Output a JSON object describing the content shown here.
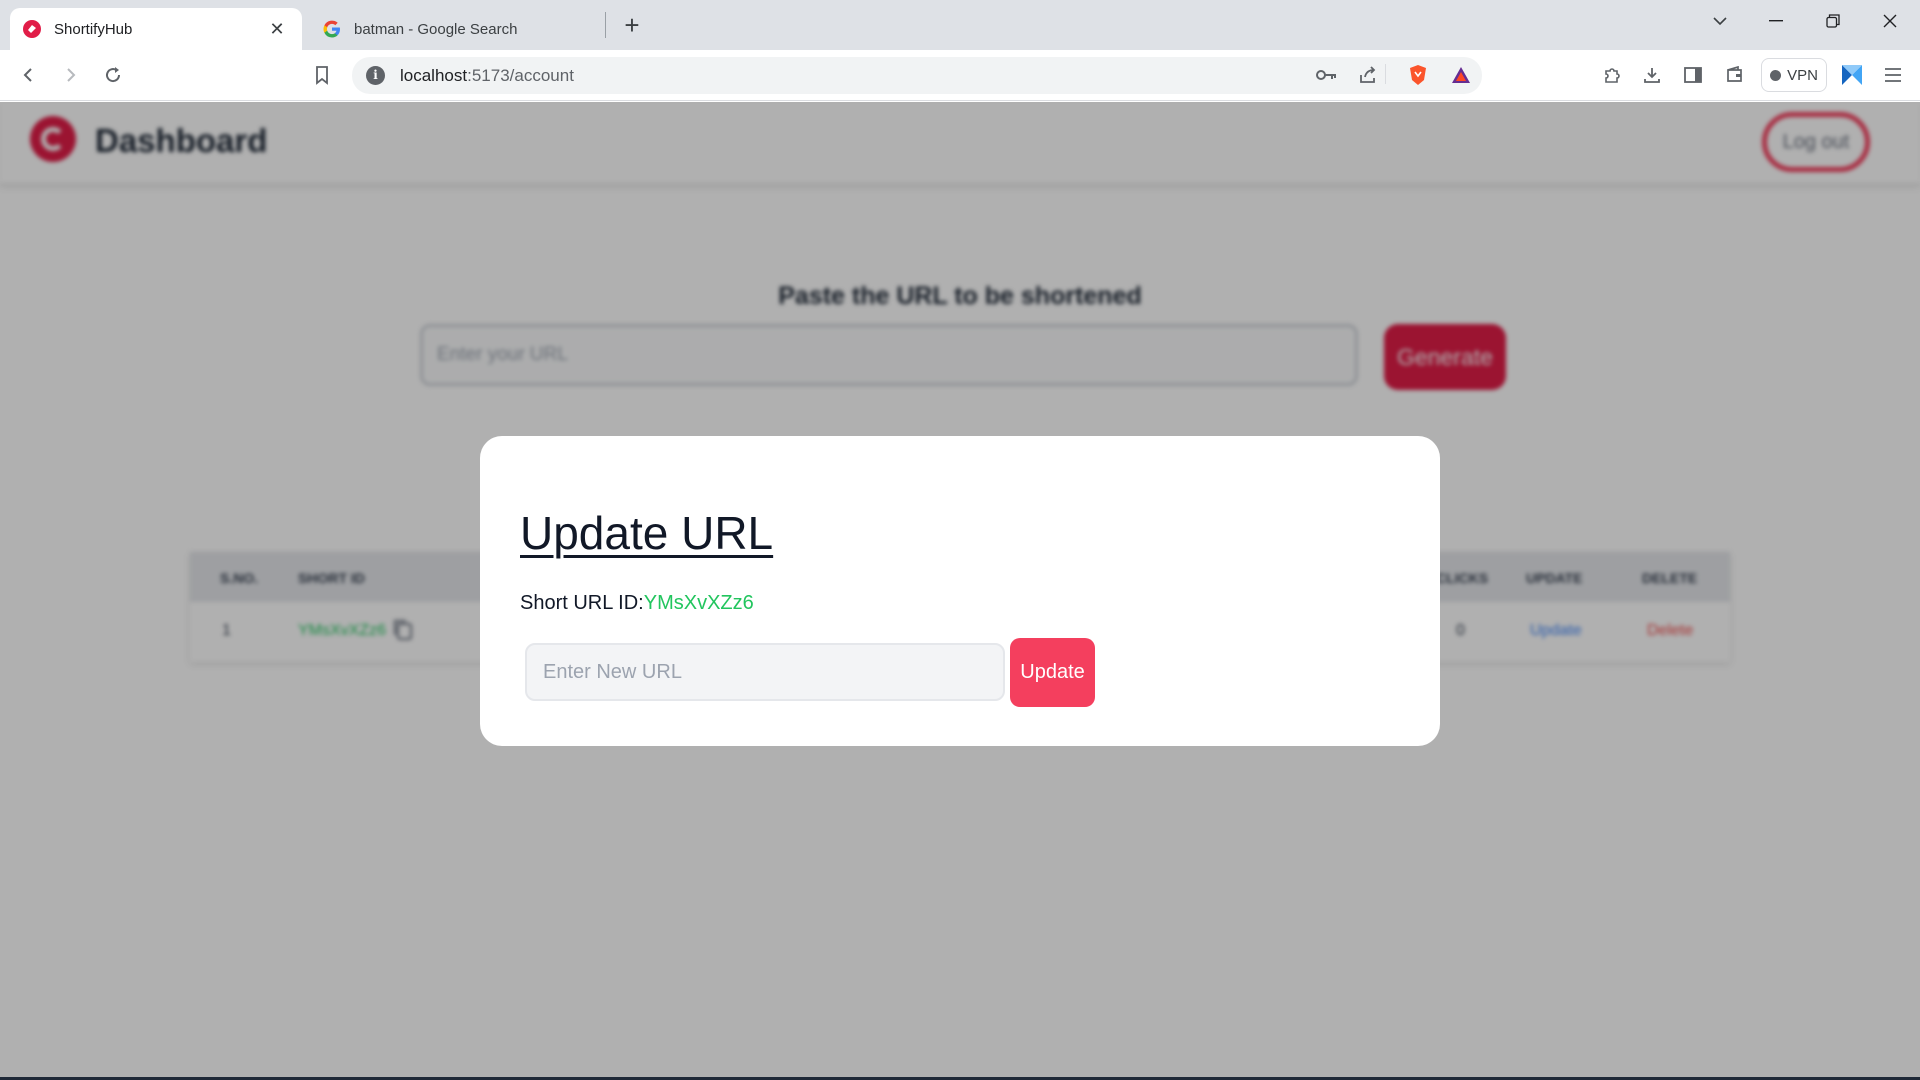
{
  "browser": {
    "tabs": [
      {
        "title": "ShortifyHub",
        "active": true,
        "icon": "shortifyhub-favicon"
      },
      {
        "title": "batman - Google Search",
        "active": false,
        "icon": "google-favicon"
      }
    ],
    "address": {
      "host": "localhost",
      "path": ":5173/account"
    },
    "vpn_label": "VPN"
  },
  "app": {
    "brand": "Dashboard",
    "logout_label": "Log out",
    "paste_title": "Paste the URL to be shortened",
    "url_placeholder": "Enter your URL",
    "generate_label": "Generate",
    "table": {
      "headers": [
        "S.NO.",
        "SHORT ID",
        "CLICKS",
        "UPDATE",
        "DELETE"
      ],
      "rows": [
        {
          "sno": "1",
          "short_id": "YMsXvXZz6",
          "clicks": "0",
          "update": "Update",
          "delete": "Delete"
        }
      ]
    },
    "colors": {
      "accent": "#e11d48",
      "button": "#f43f5e",
      "id_green": "#22c55e"
    }
  },
  "modal": {
    "title": "Update URL",
    "short_id_label": "Short URL ID:",
    "short_id_value": "YMsXvXZz6",
    "new_url_placeholder": "Enter New URL",
    "update_label": "Update"
  }
}
